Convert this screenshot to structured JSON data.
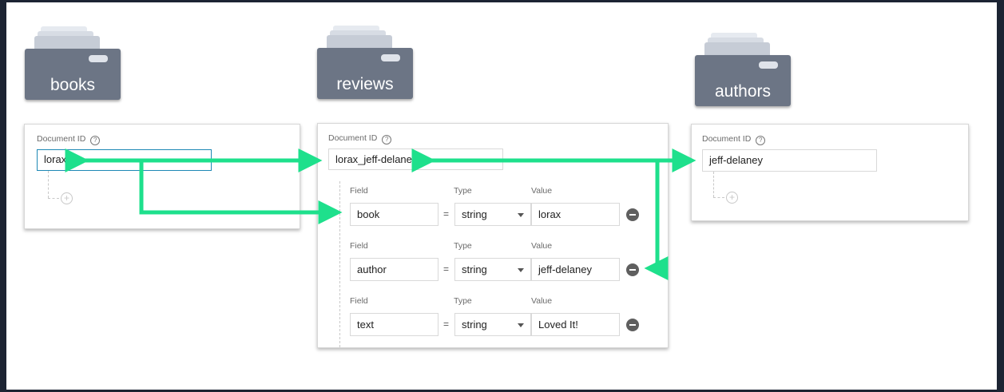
{
  "collections": {
    "books": "books",
    "reviews": "reviews",
    "authors": "authors"
  },
  "document_id_label": "Document ID",
  "help_glyph": "?",
  "books_card": {
    "doc_id": "lorax"
  },
  "reviews_card": {
    "doc_id": "lorax_jeff-delaney",
    "field_header": "Field",
    "type_header": "Type",
    "value_header": "Value",
    "fields": [
      {
        "field": "book",
        "type": "string",
        "value": "lorax"
      },
      {
        "field": "author",
        "type": "string",
        "value": "jeff-delaney"
      },
      {
        "field": "text",
        "type": "string",
        "value": "Loved It!"
      }
    ],
    "equals": "="
  },
  "authors_card": {
    "doc_id": "jeff-delaney"
  },
  "add_glyph": "+",
  "colors": {
    "arrow": "#1ee08c",
    "collection_box": "#6c7585",
    "focus_border": "#1e88b5"
  }
}
